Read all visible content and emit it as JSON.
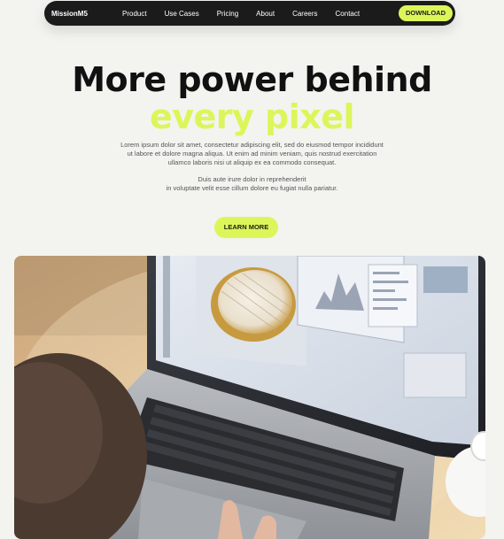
{
  "nav": {
    "brand": "MissionM5",
    "links": [
      "Product",
      "Use Cases",
      "Pricing",
      "About",
      "Careers",
      "Contact"
    ],
    "download": "DOWNLOAD"
  },
  "hero": {
    "title_line1": "More power behind",
    "title_line2": "every pixel",
    "para1_line1": "Lorem ipsum dolor sit amet, consectetur adipiscing elit, sed do eiusmod tempor incididunt",
    "para1_line2": "ut labore et dolore magna aliqua. Ut enim ad minim veniam, quis nostrud exercitation",
    "para1_line3": "ullamco laboris nisi ut aliquip ex ea commodo consequat.",
    "para2_line1": "Duis aute irure dolor in reprehenderit",
    "para2_line2": "in voluptate velit esse cillum dolore eu fugiat nulla pariatur.",
    "cta": "LEARN MORE"
  },
  "colors": {
    "accent": "#dcf65a",
    "nav_bg": "#1b1b1b",
    "page_bg": "#f3f3ef"
  }
}
